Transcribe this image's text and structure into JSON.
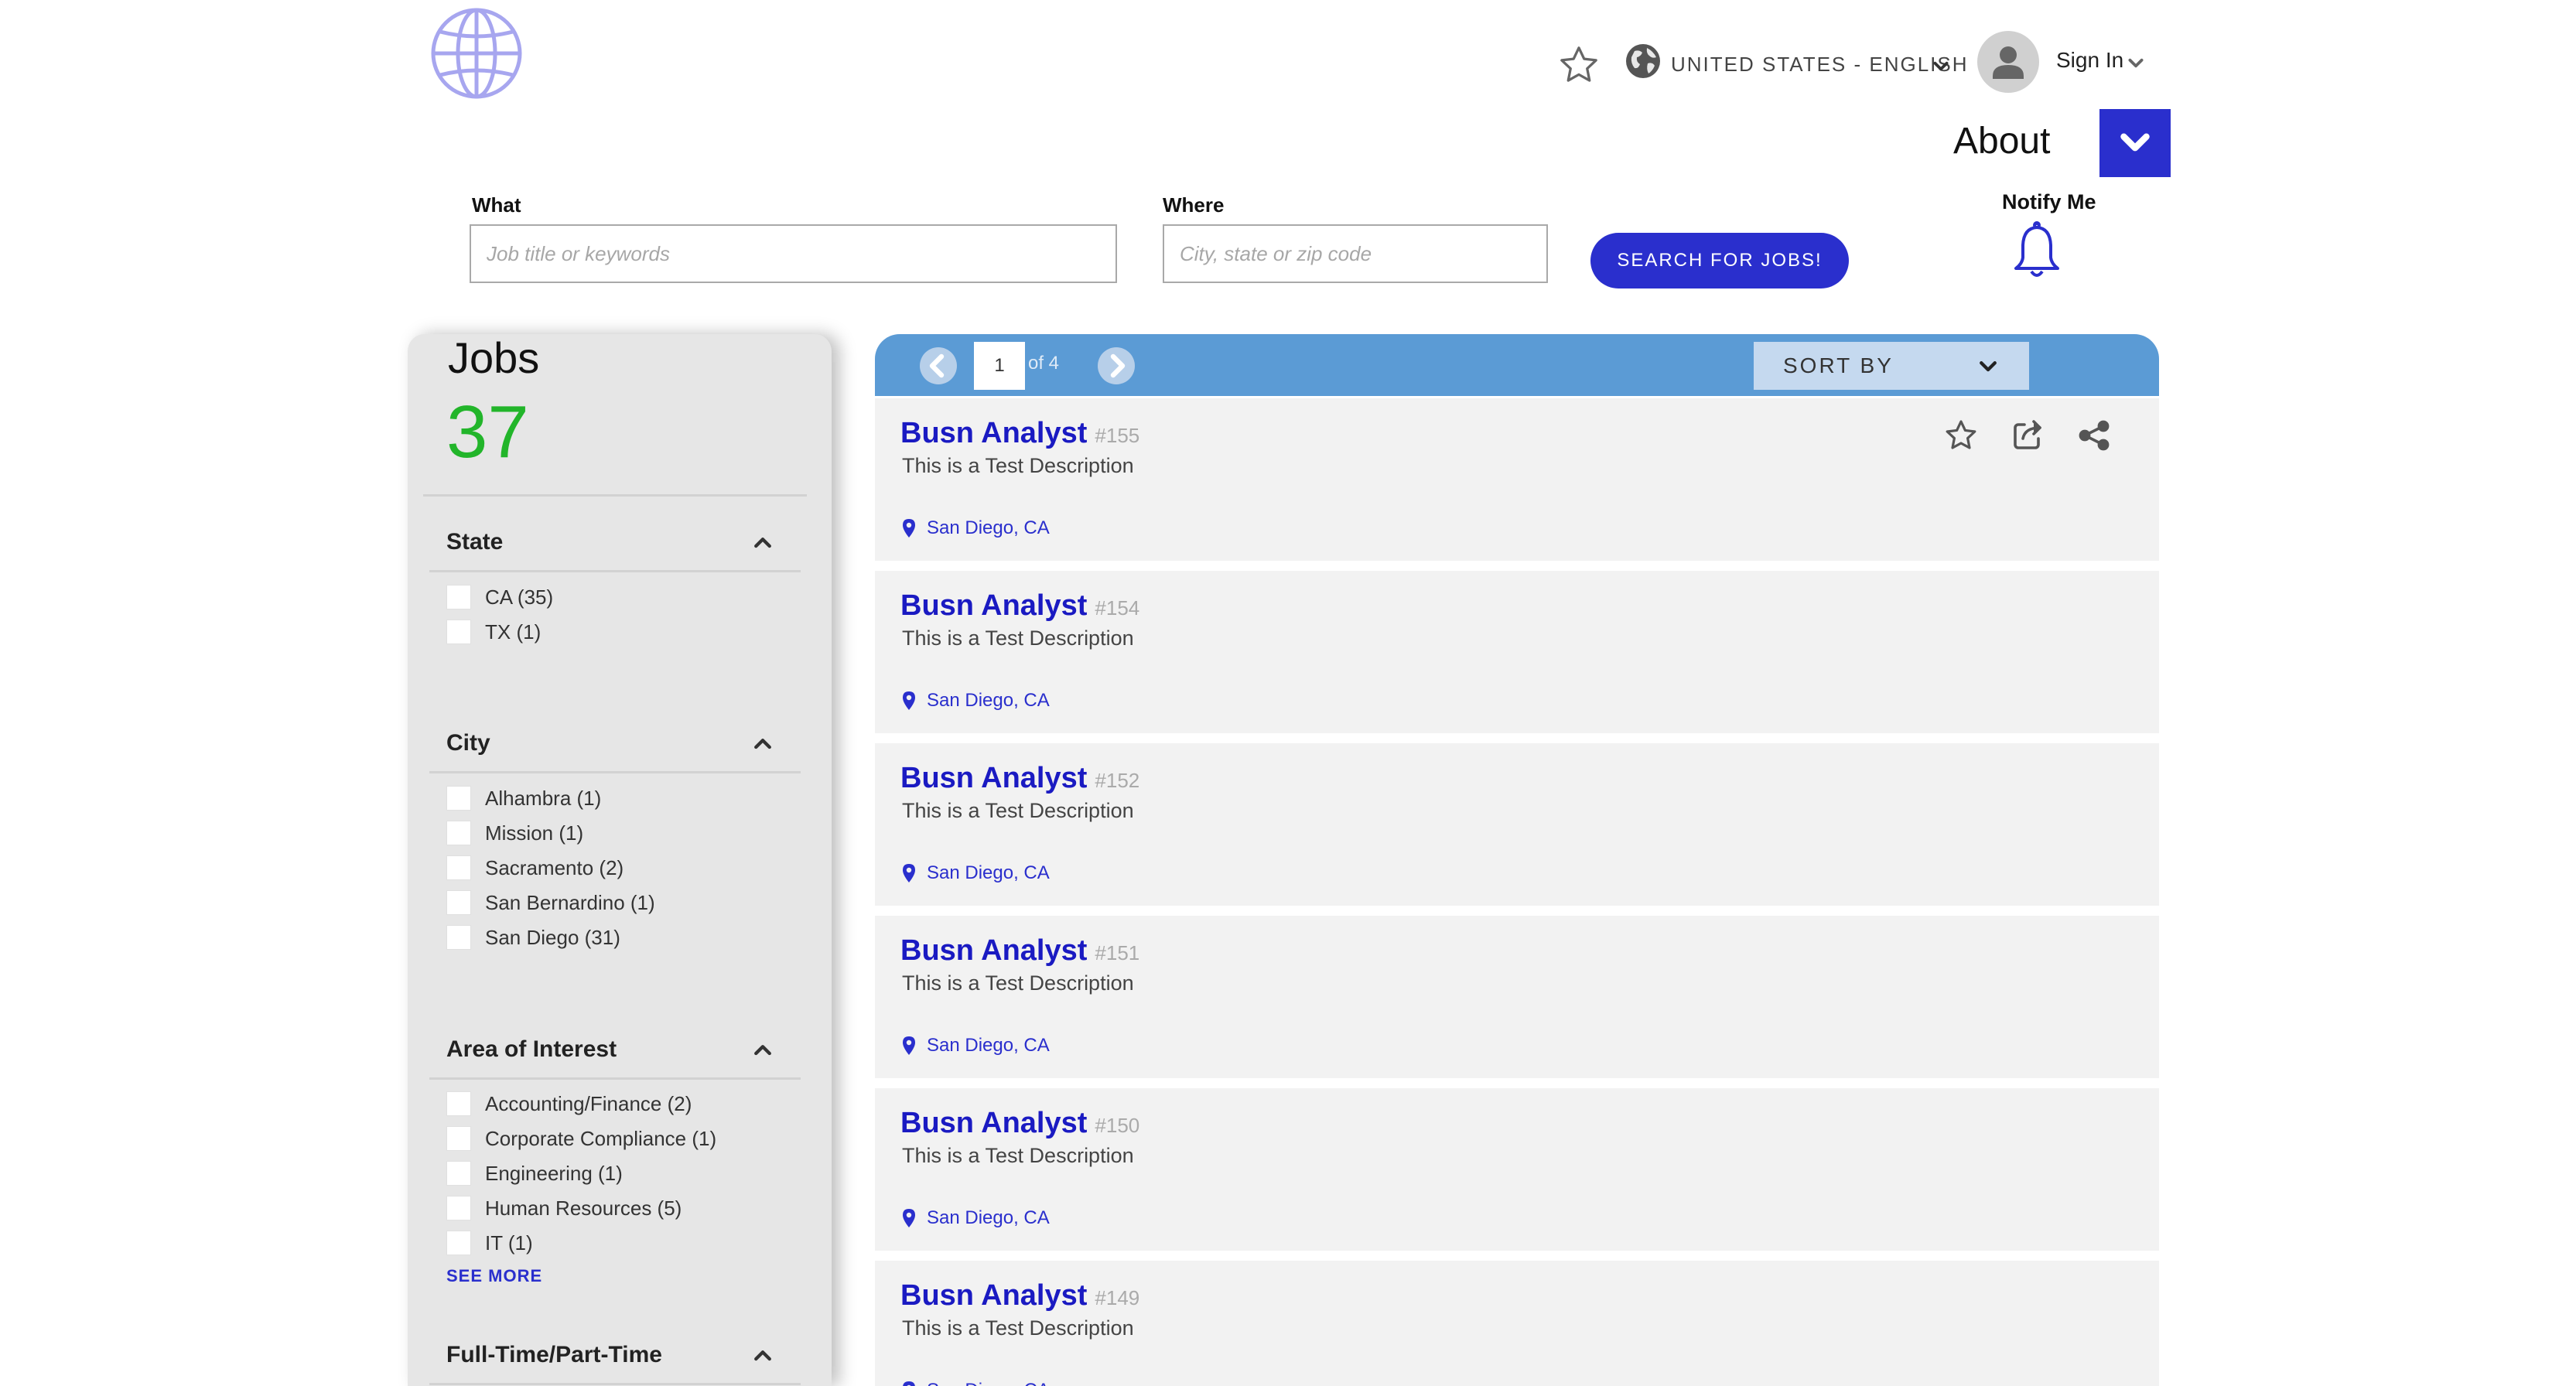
{
  "header": {
    "locale": "UNITED STATES - ENGLISH",
    "sign_in": "Sign In",
    "about": "About"
  },
  "search": {
    "what_label": "What",
    "what_placeholder": "Job title or keywords",
    "where_label": "Where",
    "where_placeholder": "City, state or zip code",
    "button": "SEARCH FOR JOBS!",
    "notify": "Notify Me"
  },
  "sidebar": {
    "title": "Jobs",
    "count": "37",
    "state": {
      "title": "State",
      "items": [
        "CA (35)",
        "TX (1)"
      ]
    },
    "city": {
      "title": "City",
      "items": [
        "Alhambra (1)",
        "Mission (1)",
        "Sacramento (2)",
        "San Bernardino (1)",
        "San Diego (31)"
      ]
    },
    "interest": {
      "title": "Area of Interest",
      "items": [
        "Accounting/Finance (2)",
        "Corporate Compliance (1)",
        "Engineering (1)",
        "Human Resources (5)",
        "IT (1)"
      ],
      "see_more": "SEE MORE"
    },
    "fulltime": {
      "title": "Full-Time/Part-Time"
    }
  },
  "results": {
    "page": "1",
    "of_pages": "of 4",
    "sort_label": "SORT BY",
    "jobs": [
      {
        "title": "Busn Analyst",
        "number": "#155",
        "desc": "This is a Test Description",
        "location": "San Diego, CA"
      },
      {
        "title": "Busn Analyst",
        "number": "#154",
        "desc": "This is a Test Description",
        "location": "San Diego, CA"
      },
      {
        "title": "Busn Analyst",
        "number": "#152",
        "desc": "This is a Test Description",
        "location": "San Diego, CA"
      },
      {
        "title": "Busn Analyst",
        "number": "#151",
        "desc": "This is a Test Description",
        "location": "San Diego, CA"
      },
      {
        "title": "Busn Analyst",
        "number": "#150",
        "desc": "This is a Test Description",
        "location": "San Diego, CA"
      },
      {
        "title": "Busn Analyst",
        "number": "#149",
        "desc": "This is a Test Description",
        "location": "San Diego, CA"
      }
    ]
  },
  "colors": {
    "accent": "#2a2fcd",
    "header_bar": "#5b9bd5",
    "count_green": "#22b52a",
    "sidebar_bg": "#e6e6e6"
  }
}
